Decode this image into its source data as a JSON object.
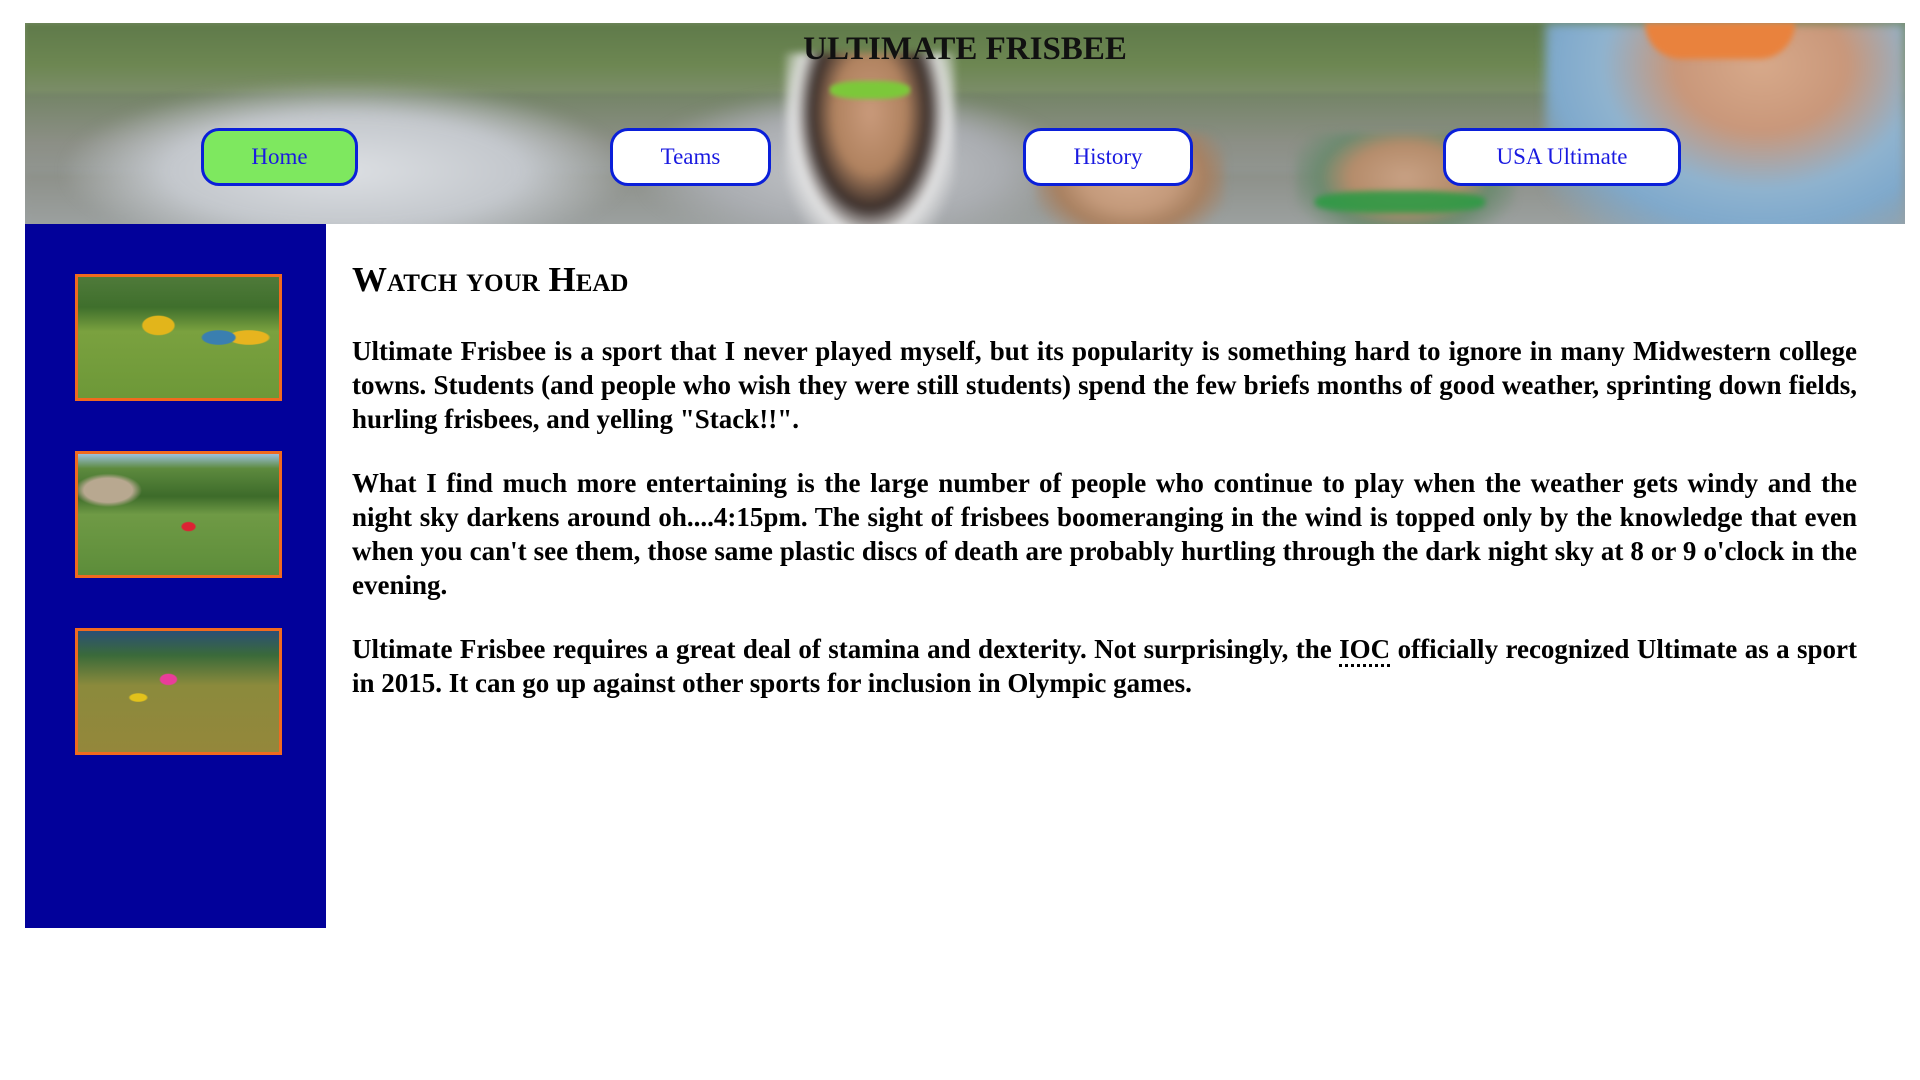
{
  "header": {
    "title": "ULTIMATE FRISBEE",
    "nav": [
      {
        "label": "Home",
        "active": true
      },
      {
        "label": "Teams",
        "active": false
      },
      {
        "label": "History",
        "active": false
      },
      {
        "label": "USA Ultimate",
        "active": false
      }
    ]
  },
  "sidebar": {
    "thumbnails": [
      {
        "icon": "frisbee-players-photo"
      },
      {
        "icon": "field-throw-photo"
      },
      {
        "icon": "disc-catch-photo"
      }
    ]
  },
  "article": {
    "heading": "Watch your Head",
    "paragraphs": [
      "Ultimate Frisbee is a sport that I never played myself, but its popularity is something hard to ignore in many Midwestern college towns. Students (and people who wish they were still students) spend the few briefs months of good weather, sprinting down fields, hurling frisbees, and yelling \"Stack!!\".",
      "What I find much more entertaining is the large number of people who continue to play when the weather gets windy and the night sky darkens around oh....4:15pm. The sight of frisbees boomeranging in the wind is topped only by the knowledge that even when you can't see them, those same plastic discs of death are probably hurtling through the dark night sky at 8 or 9 o'clock in the evening."
    ],
    "p3_before": "Ultimate Frisbee requires a great deal of stamina and dexterity. Not surprisingly, the ",
    "p3_abbr": "IOC",
    "p3_after": " officially recognized Ultimate as a sport in 2015. It can go up against other sports for inclusion in Olympic games."
  },
  "colors": {
    "sidebar_bg": "#02019a",
    "nav_border": "#0a1fd9",
    "nav_active_bg": "#7ee85f",
    "thumb_border": "#f06a1f"
  }
}
